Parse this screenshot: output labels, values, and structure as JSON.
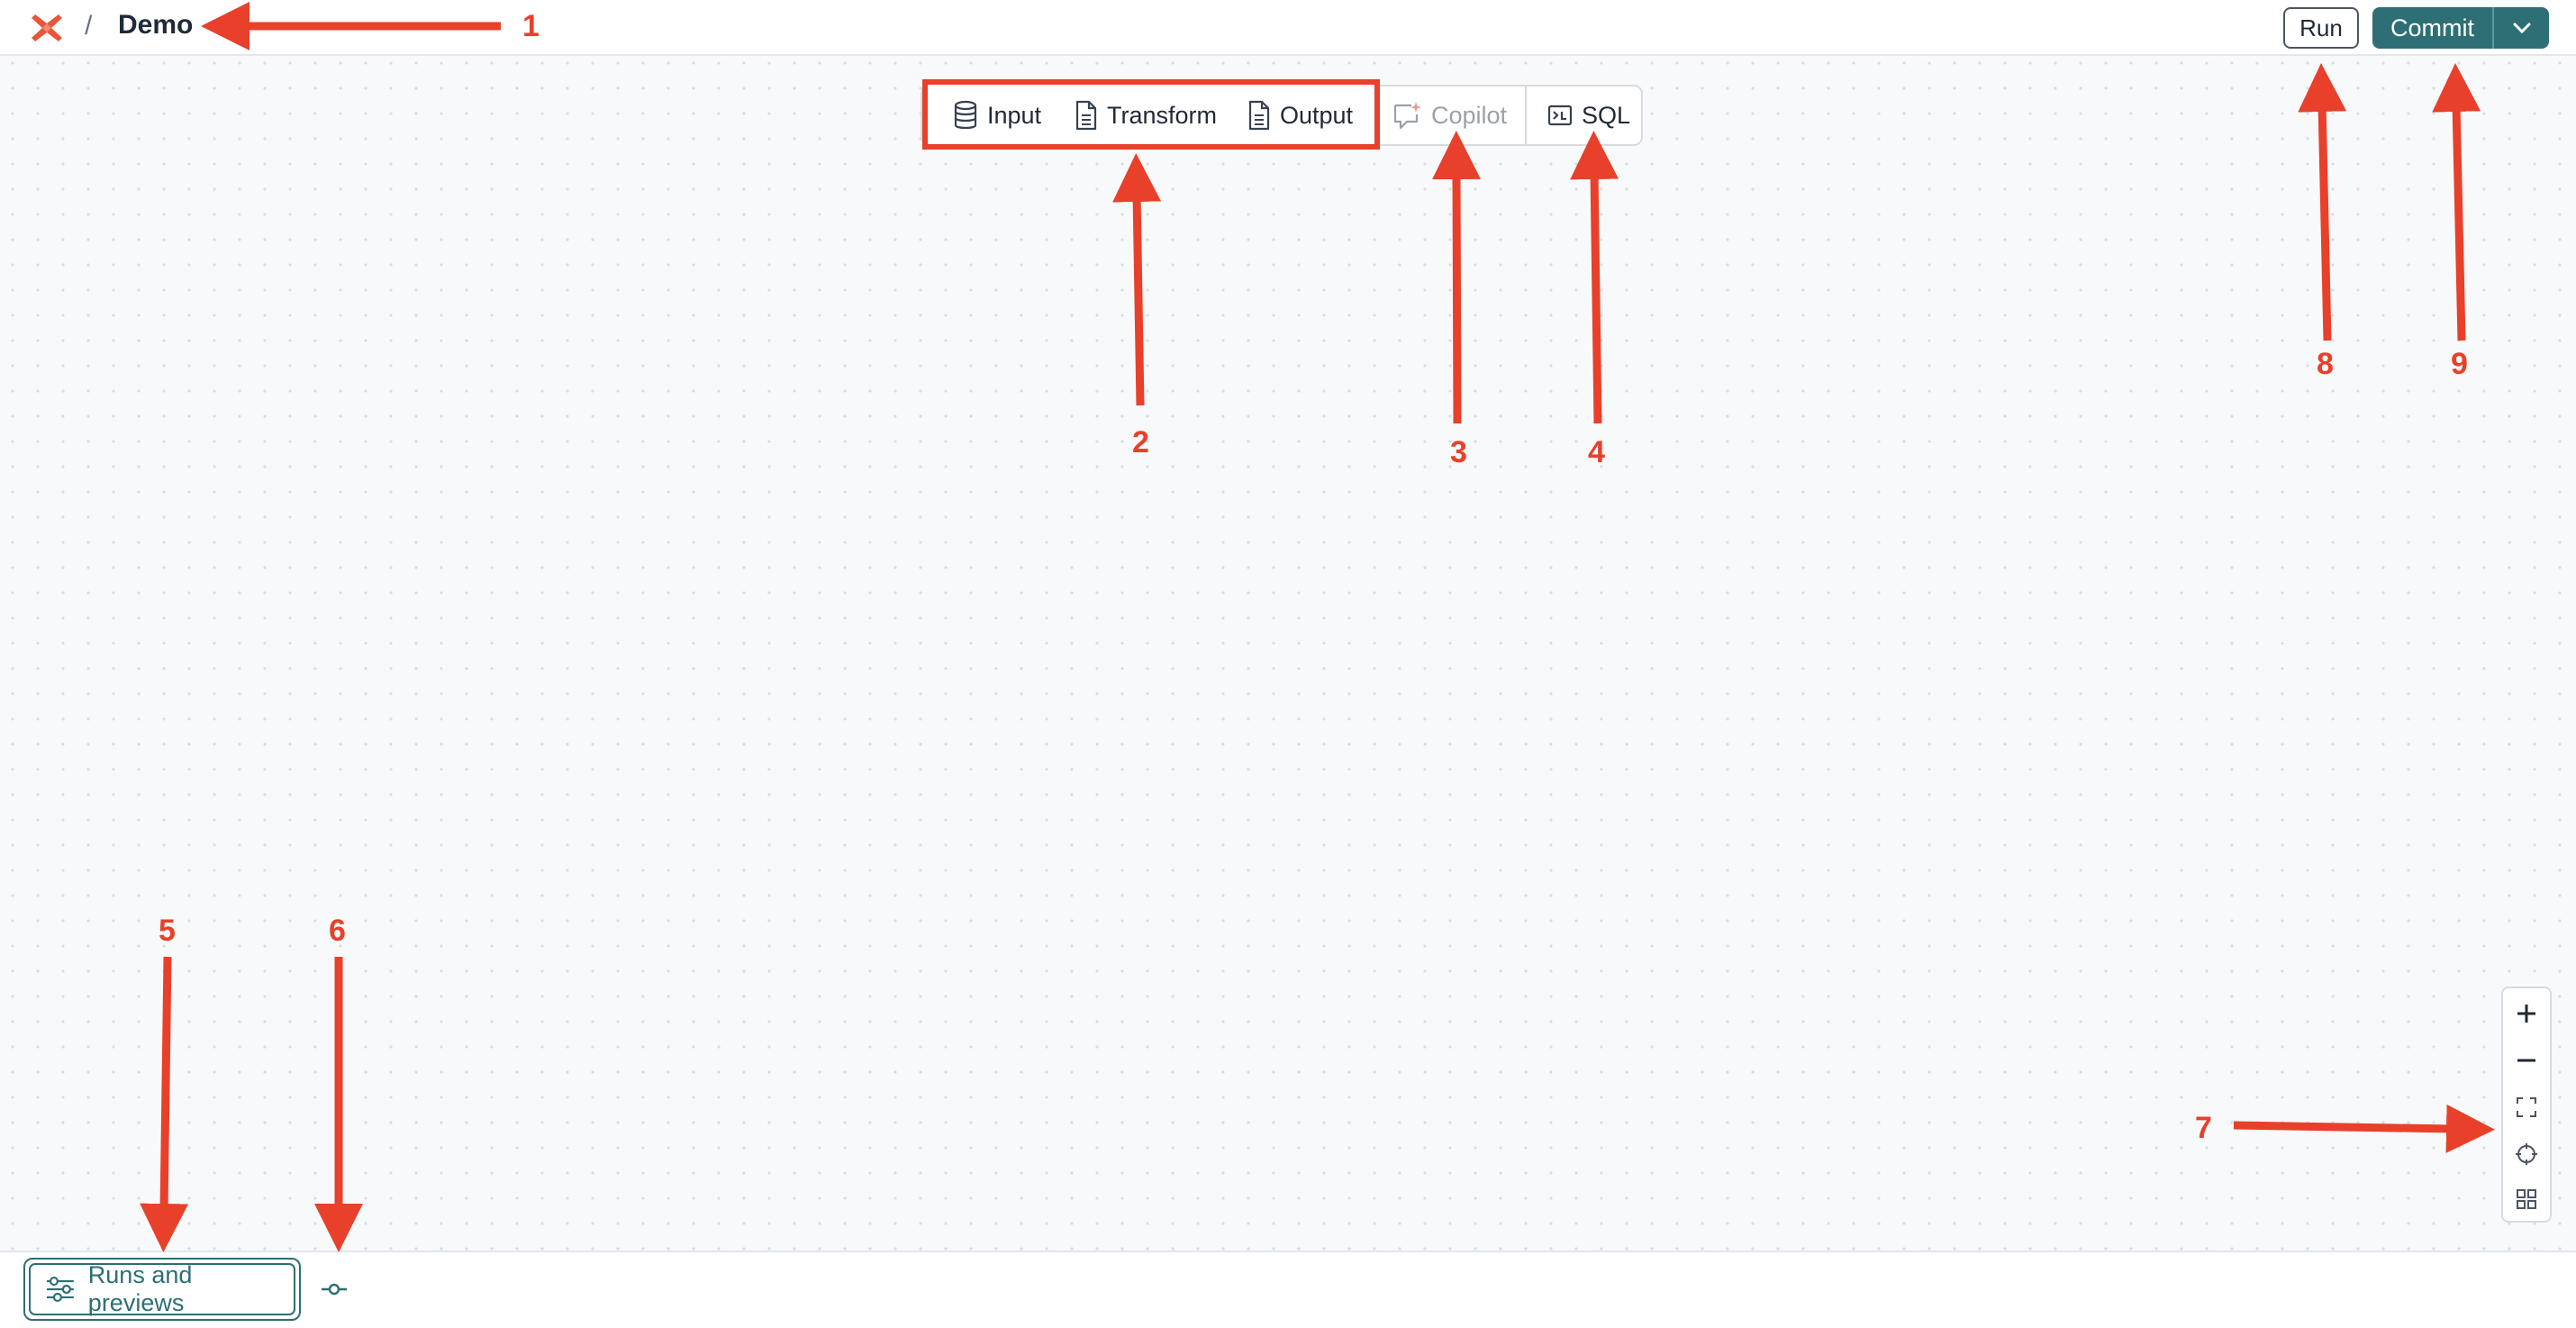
{
  "header": {
    "breadcrumb_separator": "/",
    "project_title": "Demo",
    "logo_icon": "app-logo-icon",
    "run_label": "Run",
    "commit_label": "Commit",
    "commit_menu_icon": "chevron-down-icon"
  },
  "toolbar": {
    "items": [
      {
        "label": "Input",
        "icon": "database-icon"
      },
      {
        "label": "Transform",
        "icon": "document-icon"
      },
      {
        "label": "Output",
        "icon": "document-icon"
      },
      {
        "label": "Copilot",
        "icon": "copilot-icon",
        "disabled": true
      },
      {
        "label": "SQL",
        "icon": "sql-terminal-icon"
      }
    ]
  },
  "zoom_controls": {
    "items": [
      "zoom-in-icon",
      "zoom-out-icon",
      "fit-view-icon",
      "center-view-icon",
      "minimap-icon"
    ]
  },
  "footer": {
    "runs_label": "Runs and previews",
    "runs_icon": "runs-sliders-icon",
    "commit_graph_icon": "commit-graph-icon"
  },
  "annotations": {
    "labels": [
      "1",
      "2",
      "3",
      "4",
      "5",
      "6",
      "7",
      "8",
      "9"
    ],
    "color": "#e8402a"
  },
  "colors": {
    "accent": "#2d6f74",
    "annotation": "#e8402a",
    "canvas": "#f8f9fb"
  }
}
